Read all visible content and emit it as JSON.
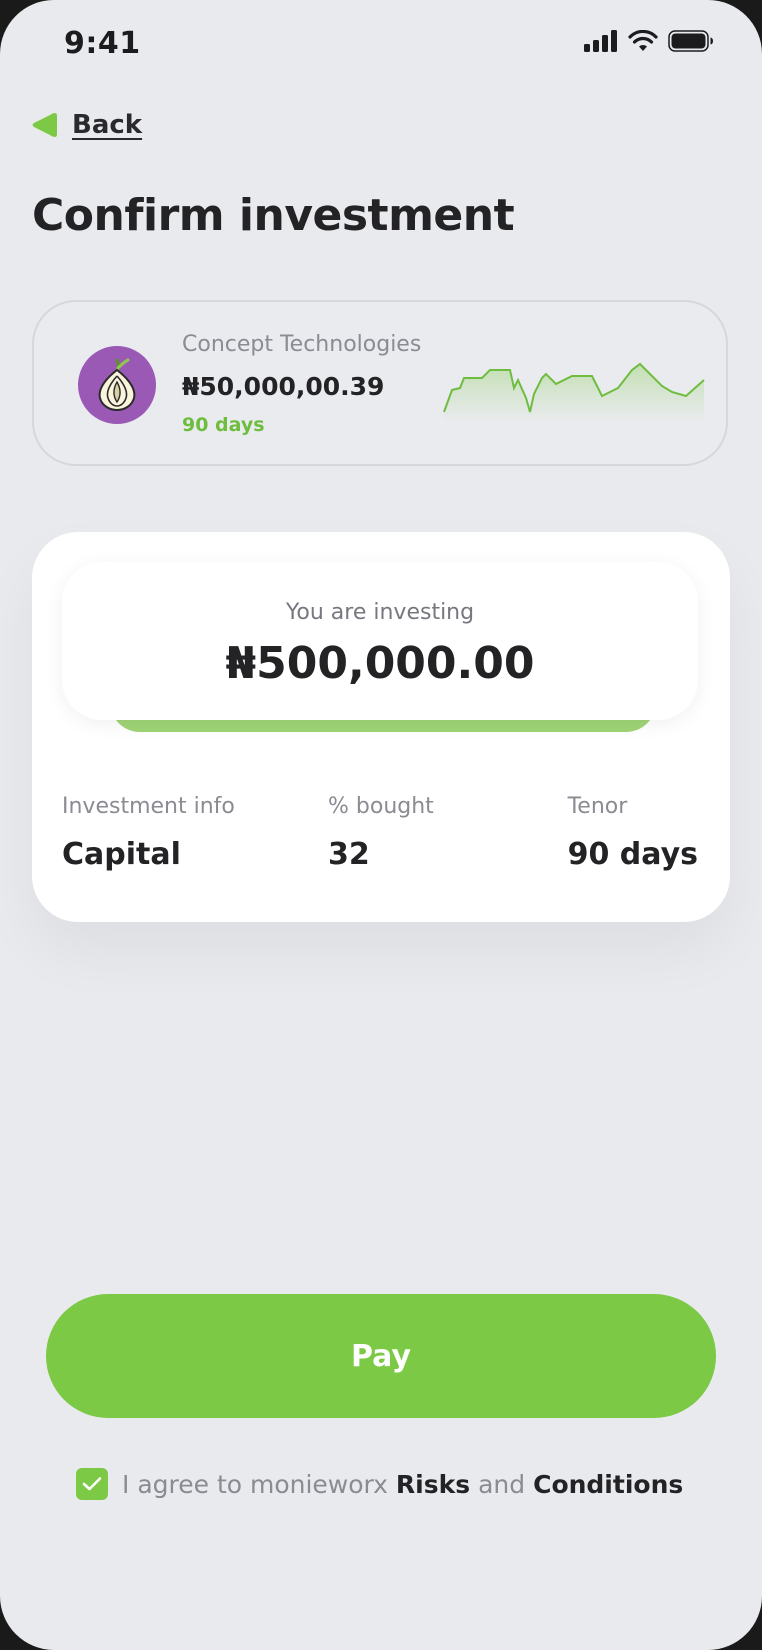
{
  "status_bar": {
    "time": "9:41"
  },
  "nav": {
    "back_label": "Back"
  },
  "page": {
    "title": "Confirm investment"
  },
  "asset": {
    "name": "Concept Technologies",
    "value": "₦50,000,00.39",
    "tenor": "90 days",
    "logo_icon": "onion-icon",
    "sparkline_color": "#6fbd3f"
  },
  "investment": {
    "label": "You are investing",
    "amount": "₦500,000.00",
    "info": [
      {
        "header": "Investment info",
        "value": "Capital"
      },
      {
        "header": "% bought",
        "value": "32"
      },
      {
        "header": "Tenor",
        "value": "90 days"
      }
    ]
  },
  "actions": {
    "pay_label": "Pay"
  },
  "agreement": {
    "checked": true,
    "prefix": "I agree to monieworx",
    "risks": "Risks",
    "and": "and",
    "conditions": "Conditions"
  },
  "colors": {
    "accent": "#7bc944",
    "background": "#e9eaee",
    "text": "#232325"
  }
}
